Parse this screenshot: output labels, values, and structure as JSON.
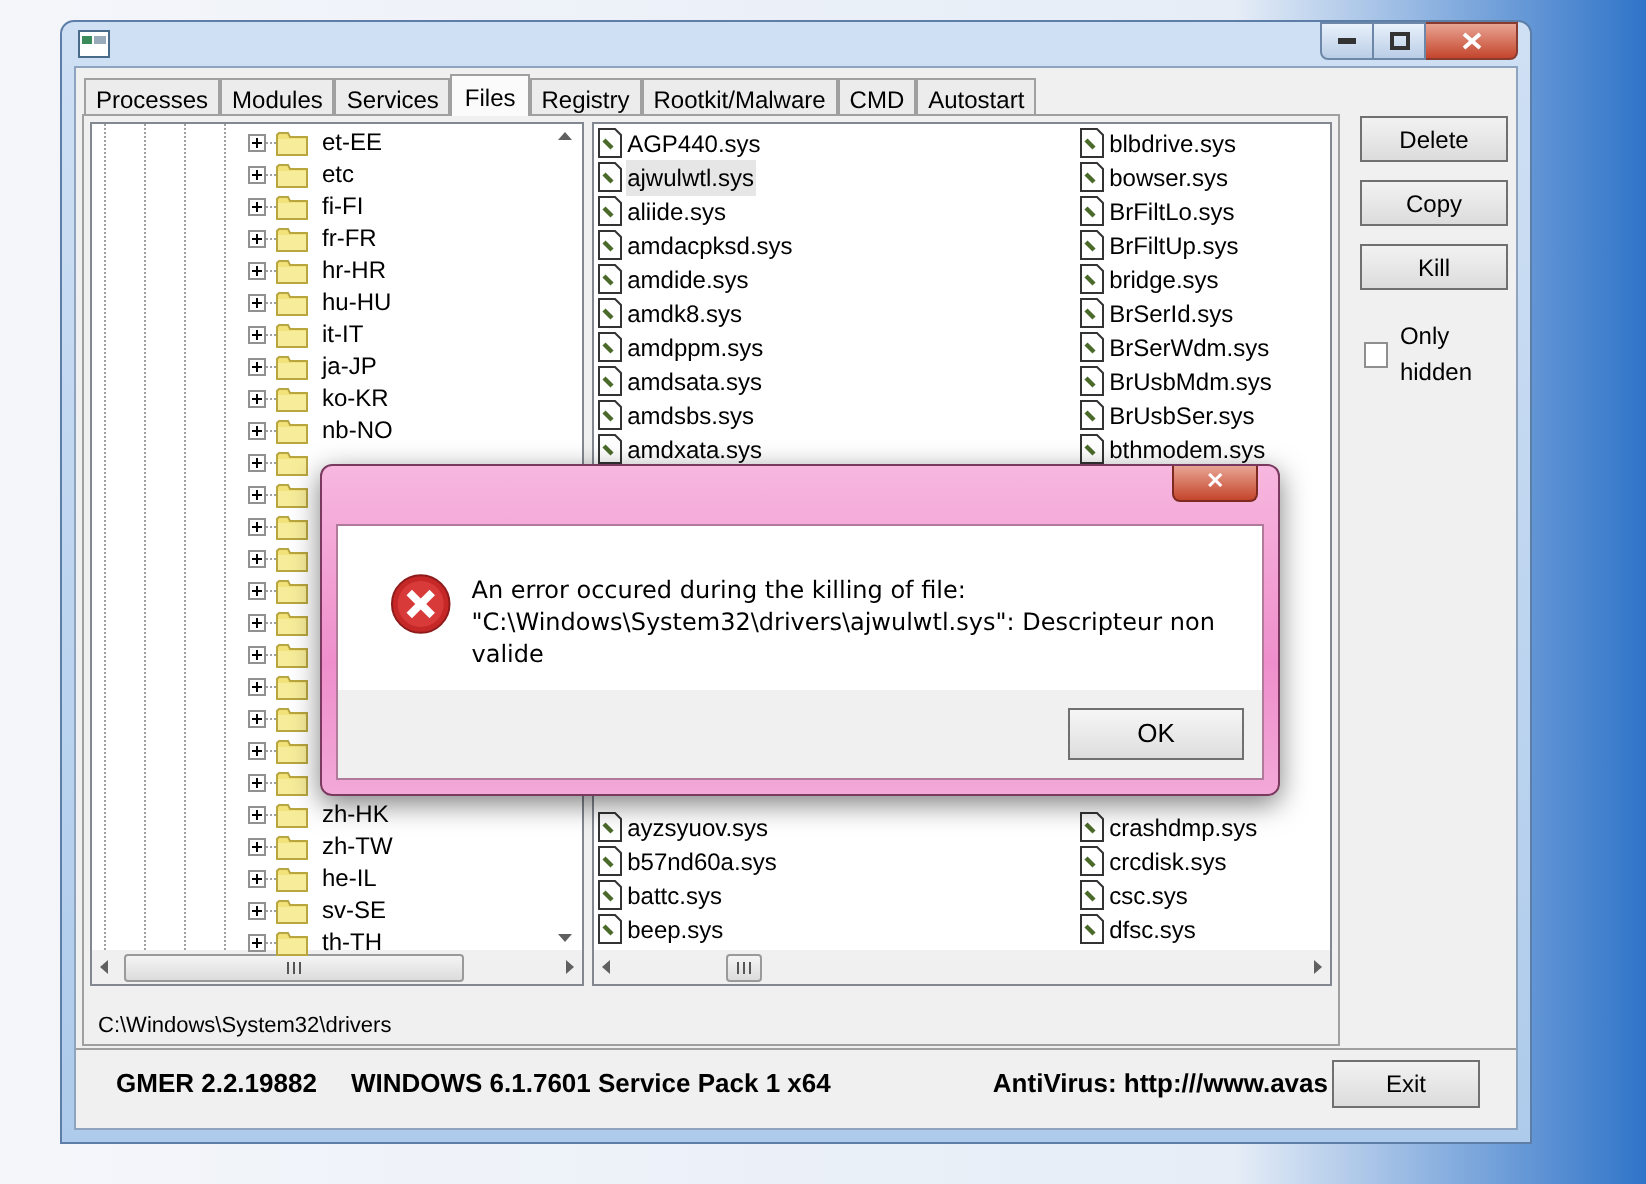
{
  "tabs": [
    {
      "label": "Processes",
      "selected": false
    },
    {
      "label": "Modules",
      "selected": false
    },
    {
      "label": "Services",
      "selected": false
    },
    {
      "label": "Files",
      "selected": true
    },
    {
      "label": "Registry",
      "selected": false
    },
    {
      "label": "Rootkit/Malware",
      "selected": false
    },
    {
      "label": "CMD",
      "selected": false
    },
    {
      "label": "Autostart",
      "selected": false
    }
  ],
  "tree": [
    {
      "label": "et-EE",
      "expanded": false
    },
    {
      "label": "etc",
      "expanded": false
    },
    {
      "label": "fi-FI",
      "expanded": false
    },
    {
      "label": "fr-FR",
      "expanded": false
    },
    {
      "label": "hr-HR",
      "expanded": false
    },
    {
      "label": "hu-HU",
      "expanded": false
    },
    {
      "label": "it-IT",
      "expanded": false
    },
    {
      "label": "ja-JP",
      "expanded": false
    },
    {
      "label": "ko-KR",
      "expanded": false
    },
    {
      "label": "nb-NO",
      "expanded": false
    },
    {
      "expanded": false
    },
    {
      "expanded": false
    },
    {
      "expanded": false
    },
    {
      "expanded": false
    },
    {
      "expanded": false
    },
    {
      "expanded": false
    },
    {
      "expanded": false
    },
    {
      "expanded": false
    },
    {
      "expanded": false
    },
    {
      "expanded": false
    },
    {
      "expanded": false
    },
    {
      "label": "zh-HK",
      "expanded": false
    },
    {
      "label": "zh-TW",
      "expanded": false
    },
    {
      "label": "he-IL",
      "expanded": false
    },
    {
      "label": "sv-SE",
      "expanded": false
    },
    {
      "label": "th-TH",
      "expanded": false
    }
  ],
  "files": {
    "upper": [
      [
        {
          "name": "AGP440.sys",
          "selected": false
        },
        {
          "name": "blbdrive.sys",
          "selected": false
        }
      ],
      [
        {
          "name": "ajwulwtl.sys",
          "selected": true
        },
        {
          "name": "bowser.sys",
          "selected": false
        }
      ],
      [
        {
          "name": "aliide.sys",
          "selected": false
        },
        {
          "name": "BrFiltLo.sys",
          "selected": false
        }
      ],
      [
        {
          "name": "amdacpksd.sys",
          "selected": false
        },
        {
          "name": "BrFiltUp.sys",
          "selected": false
        }
      ],
      [
        {
          "name": "amdide.sys",
          "selected": false
        },
        {
          "name": "bridge.sys",
          "selected": false
        }
      ],
      [
        {
          "name": "amdk8.sys",
          "selected": false
        },
        {
          "name": "BrSerId.sys",
          "selected": false
        }
      ],
      [
        {
          "name": "amdppm.sys",
          "selected": false
        },
        {
          "name": "BrSerWdm.sys",
          "selected": false
        }
      ],
      [
        {
          "name": "amdsata.sys",
          "selected": false
        },
        {
          "name": "BrUsbMdm.sys",
          "selected": false
        }
      ],
      [
        {
          "name": "amdsbs.sys",
          "selected": false
        },
        {
          "name": "BrUsbSer.sys",
          "selected": false
        }
      ],
      [
        {
          "name": "amdxata.sys",
          "selected": false
        },
        {
          "name": "bthmodem.sys",
          "selected": false
        }
      ]
    ],
    "lower": [
      [
        {
          "name": "ayzsyuov.sys",
          "selected": false
        },
        {
          "name": "crashdmp.sys",
          "selected": false
        }
      ],
      [
        {
          "name": "b57nd60a.sys",
          "selected": false
        },
        {
          "name": "crcdisk.sys",
          "selected": false
        }
      ],
      [
        {
          "name": "battc.sys",
          "selected": false
        },
        {
          "name": "csc.sys",
          "selected": false
        }
      ],
      [
        {
          "name": "beep.sys",
          "selected": false
        },
        {
          "name": "dfsc.sys",
          "selected": false
        }
      ]
    ]
  },
  "path": "C:\\Windows\\System32\\drivers",
  "actions": [
    "Delete",
    "Copy",
    "Kill"
  ],
  "only_hidden": {
    "label": "Only hidden",
    "checked": false
  },
  "status_bar": {
    "version": "GMER 2.2.19882",
    "os": "WINDOWS 6.1.7601 Service Pack 1 x64",
    "antivirus": "AntiVirus: http:///www.avas",
    "exit": "Exit"
  },
  "dialog": {
    "message": "An error occured during the killing of file:\n\"C:\\Windows\\System32\\drivers\\ajwulwtl.sys\": Descripteur non valide",
    "close": "✕",
    "ok": "OK"
  }
}
